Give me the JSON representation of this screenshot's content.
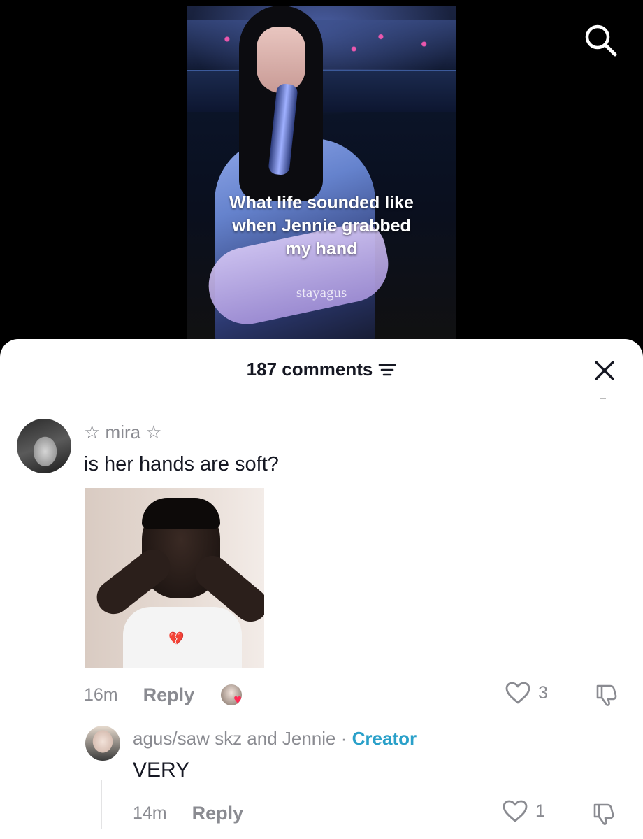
{
  "video": {
    "caption_lines": [
      "What life sounded like",
      "when Jennie grabbed",
      "my hand"
    ],
    "watermark": "stayagus"
  },
  "header": {
    "search_icon": "search-icon"
  },
  "comments_sheet": {
    "title": "187 comments",
    "sort_icon": "sort-lines-icon",
    "close_icon": "close-icon"
  },
  "comments": [
    {
      "username": "☆ mira ☆",
      "text": "is her hands are soft?",
      "media": "crying-man-gif",
      "time": "16m",
      "reply_label": "Reply",
      "liked_by_creator": true,
      "likes": "3"
    }
  ],
  "replies": [
    {
      "username": "agus/saw skz and Jennie",
      "separator": "·",
      "badge": "Creator",
      "text": "VERY",
      "time": "14m",
      "reply_label": "Reply",
      "likes": "1"
    }
  ],
  "colors": {
    "creator_badge": "#2aa0c9",
    "like_heart": "#ff2c55",
    "muted_text": "#8a8b91",
    "primary_text": "#161823"
  }
}
